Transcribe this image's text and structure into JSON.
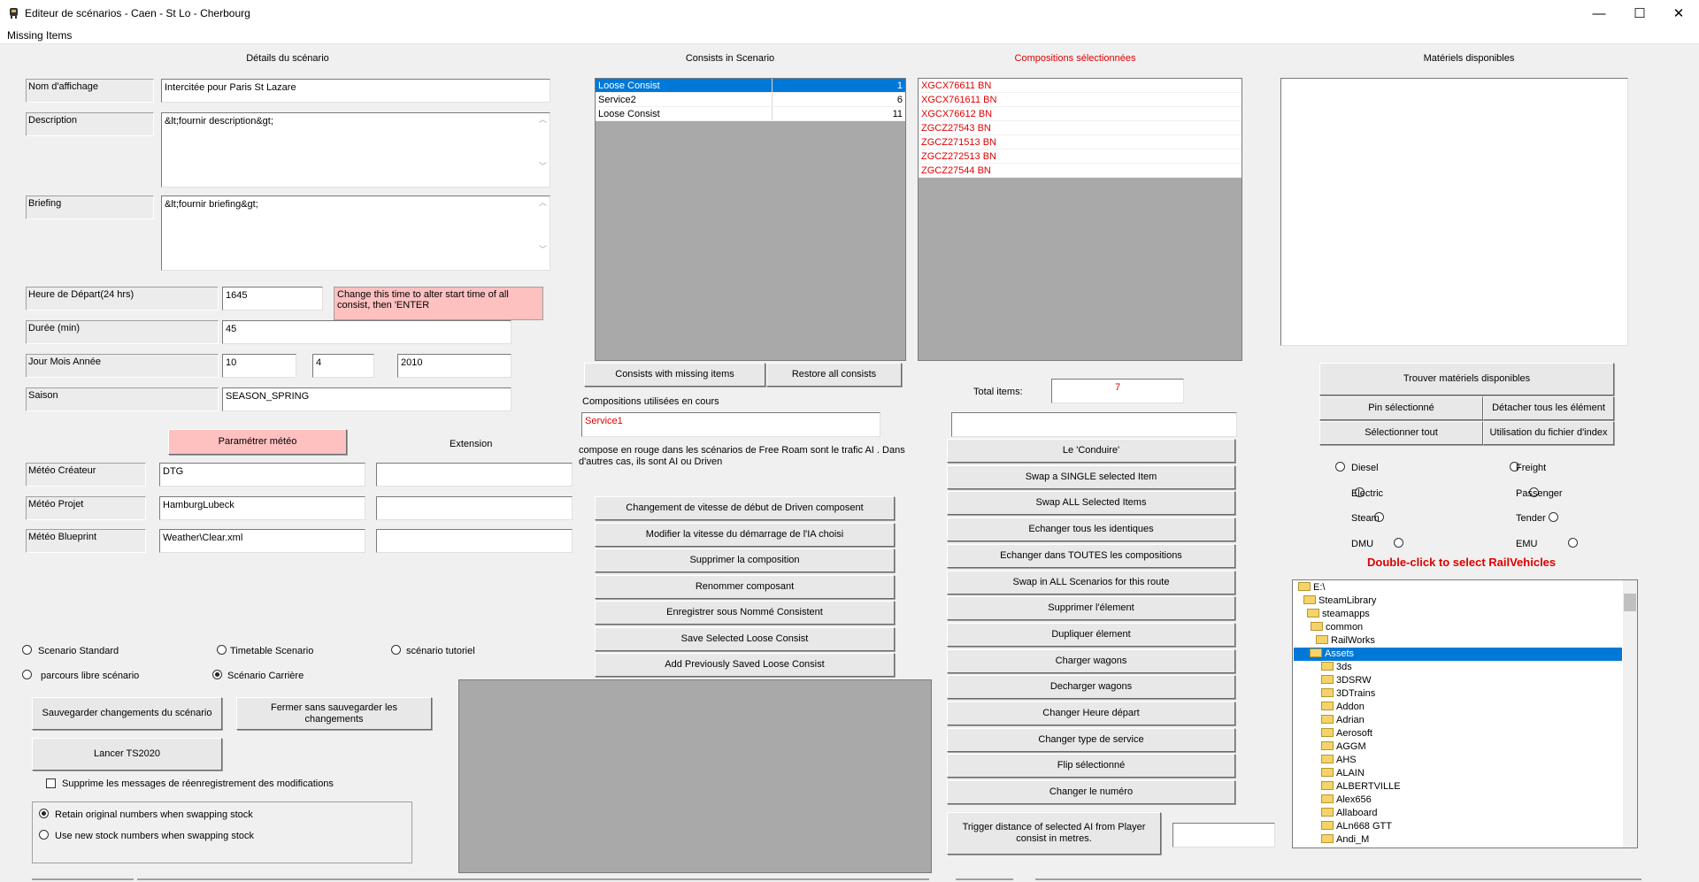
{
  "window": {
    "title": "Editeur de scénarios - Caen - St Lo - Cherbourg",
    "minimize": "—",
    "maximize": "☐",
    "close": "✕"
  },
  "menu": {
    "missing_items": "Missing Items"
  },
  "details": {
    "header": "Détails du scénario",
    "name_label": "Nom d'affichage",
    "name_value": "Intercitée pour Paris St Lazare",
    "description_label": "Description",
    "description_value": "&lt;fournir description&gt;",
    "briefing_label": "Briefing",
    "briefing_value": "&lt;fournir briefing&gt;",
    "start_label": "Heure de Départ(24 hrs)",
    "start_value": "1645",
    "start_hint": "Change this time to alter start time of all consist, then 'ENTER",
    "duration_label": "Durée (min)",
    "duration_value": "45",
    "date_label": "Jour Mois Année",
    "day": "10",
    "month": "4",
    "year": "2010",
    "season_label": "Saison",
    "season_value": "SEASON_SPRING"
  },
  "weather": {
    "button": "Paramétrer météo",
    "extension_label": "Extension",
    "creator_label": "Météo Créateur",
    "creator_value": "DTG",
    "project_label": "Météo Projet",
    "project_value": "HamburgLubeck",
    "blueprint_label": "Météo Blueprint",
    "blueprint_value": "Weather\\Clear.xml"
  },
  "scenario_types": {
    "standard": "Scenario Standard",
    "timetable": "Timetable Scenario",
    "tutorial": "scénario tutoriel",
    "free_roam": "parcours libre scénario",
    "career": "Scénario Carrière"
  },
  "bottom_left": {
    "save_button": "Sauvegarder changements du scénario",
    "close_button": "Fermer sans sauvegarder les changements",
    "launch_button": "Lancer TS2020",
    "suppress_label": "Supprime les messages de réenregistrement des modifications",
    "retain_label": "Retain original numbers when swapping stock",
    "newnum_label": "Use new stock numbers  when swapping stock"
  },
  "consists": {
    "header": "Consists in Scenario",
    "rows": [
      {
        "name": "Loose Consist",
        "count": "1"
      },
      {
        "name": "Service2",
        "count": "6"
      },
      {
        "name": "Loose Consist",
        "count": "11"
      }
    ],
    "missing_button": "Consists with missing items",
    "restore_button": "Restore all consists",
    "in_use_label": "Compositions utilisées en cours",
    "in_use_value": "Service1",
    "note": "compose en rouge dans les scénarios de Free Roam sont le trafic AI . Dans d'autres cas, ils sont AI ou Driven",
    "actions": [
      "Changement de vitesse de début de Driven composent",
      "Modifier la vitesse du démarrage de l'IA choisi",
      "Supprimer la composition",
      "Renommer composant",
      "Enregistrer sous Nommé Consistent",
      "Save Selected Loose Consist",
      "Add Previously Saved Loose Consist"
    ]
  },
  "selected": {
    "header": "Compositions sélectionnées",
    "items": [
      "XGCX76611 BN",
      "XGCX761611 BN",
      "XGCX76612 BN",
      "ZGCZ27543 BN",
      "ZGCZ271513 BN",
      "ZGCZ272513 BN",
      "ZGCZ27544 BN"
    ],
    "total_label": "Total items:",
    "total_value": "7",
    "actions": [
      "Le 'Conduire'",
      "Swap a SINGLE selected Item",
      "Swap ALL Selected Items",
      "Echanger tous les identiques",
      "Echanger dans TOUTES les compositions",
      "Swap in ALL Scenarios for this route",
      "Supprimer l'élement",
      "Dupliquer élement",
      "Charger wagons",
      "Decharger wagons",
      "Changer Heure départ",
      "Changer type de service",
      "Flip sélectionné",
      "Changer le numéro"
    ],
    "trigger_button": "Trigger distance of selected AI from Player consist in metres."
  },
  "materials": {
    "header": "Matériels disponibles",
    "find_button": "Trouver matériels disponibles",
    "pin_button": "Pin sélectionné",
    "detach_button": "Détacher tous les élément",
    "select_all_button": "Sélectionner tout",
    "index_button": "Utilisation du fichier d'index",
    "types": [
      "Diesel",
      "Freight",
      "Electric",
      "Passenger",
      "Steam",
      "Tender",
      "DMU",
      "EMU"
    ],
    "dblclick_hint": "Double-click to select RailVehicles",
    "tree": [
      "E:\\",
      "SteamLibrary",
      "steamapps",
      "common",
      "RailWorks",
      "Assets",
      "3ds",
      "3DSRW",
      "3DTrains",
      "Addon",
      "Adrian",
      "Aerosoft",
      "AGGM",
      "AHS",
      "ALAIN",
      "ALBERTVILLE",
      "Alex656",
      "Allaboard",
      "ALn668 GTT",
      "Andi_M"
    ]
  },
  "colors": {
    "pink": "#ffc0c0",
    "select_blue": "#0078d7",
    "red_text": "#e00000",
    "panel_gray": "#a9a9a9"
  }
}
